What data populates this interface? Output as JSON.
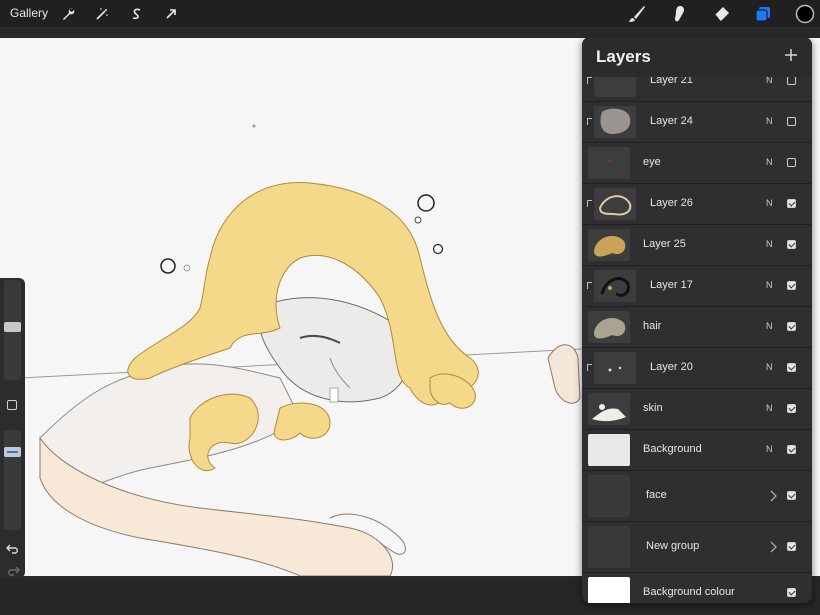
{
  "toolbar": {
    "gallery_label": "Gallery",
    "left_icons": [
      "wrench-icon",
      "magic-wand-icon",
      "selection-icon",
      "transform-arrow-icon"
    ],
    "right_icons": [
      "brush-icon",
      "smudge-icon",
      "eraser-icon",
      "layers-icon",
      "color-swatch-icon"
    ],
    "accent_color": "#1a7cf5",
    "current_color": "#000000"
  },
  "layers_panel": {
    "title": "Layers",
    "add_icon": "plus-icon",
    "layers": [
      {
        "name": "Layer 21",
        "blend": "N",
        "visible": false,
        "clipped": true
      },
      {
        "name": "Layer 24",
        "blend": "N",
        "visible": false,
        "clipped": true
      },
      {
        "name": "eye",
        "blend": "N",
        "visible": false,
        "clipped": false
      },
      {
        "name": "Layer 26",
        "blend": "N",
        "visible": true,
        "clipped": true
      },
      {
        "name": "Layer 25",
        "blend": "N",
        "visible": true,
        "clipped": false
      },
      {
        "name": "Layer 17",
        "blend": "N",
        "visible": true,
        "clipped": true
      },
      {
        "name": "hair",
        "blend": "N",
        "visible": true,
        "clipped": false
      },
      {
        "name": "Layer 20",
        "blend": "N",
        "visible": true,
        "clipped": true
      },
      {
        "name": "skin",
        "blend": "N",
        "visible": true,
        "clipped": false
      },
      {
        "name": "Background",
        "blend": "N",
        "visible": true,
        "clipped": false
      },
      {
        "name": "face",
        "blend": "",
        "visible": true,
        "group": true
      },
      {
        "name": "New group",
        "blend": "",
        "visible": true,
        "group": true
      },
      {
        "name": "Background colour",
        "blend": "",
        "visible": true,
        "background_colour": "#ffffff"
      }
    ]
  },
  "sidebar": {
    "icons": [
      "square-modify-icon",
      "undo-icon",
      "redo-icon"
    ]
  }
}
